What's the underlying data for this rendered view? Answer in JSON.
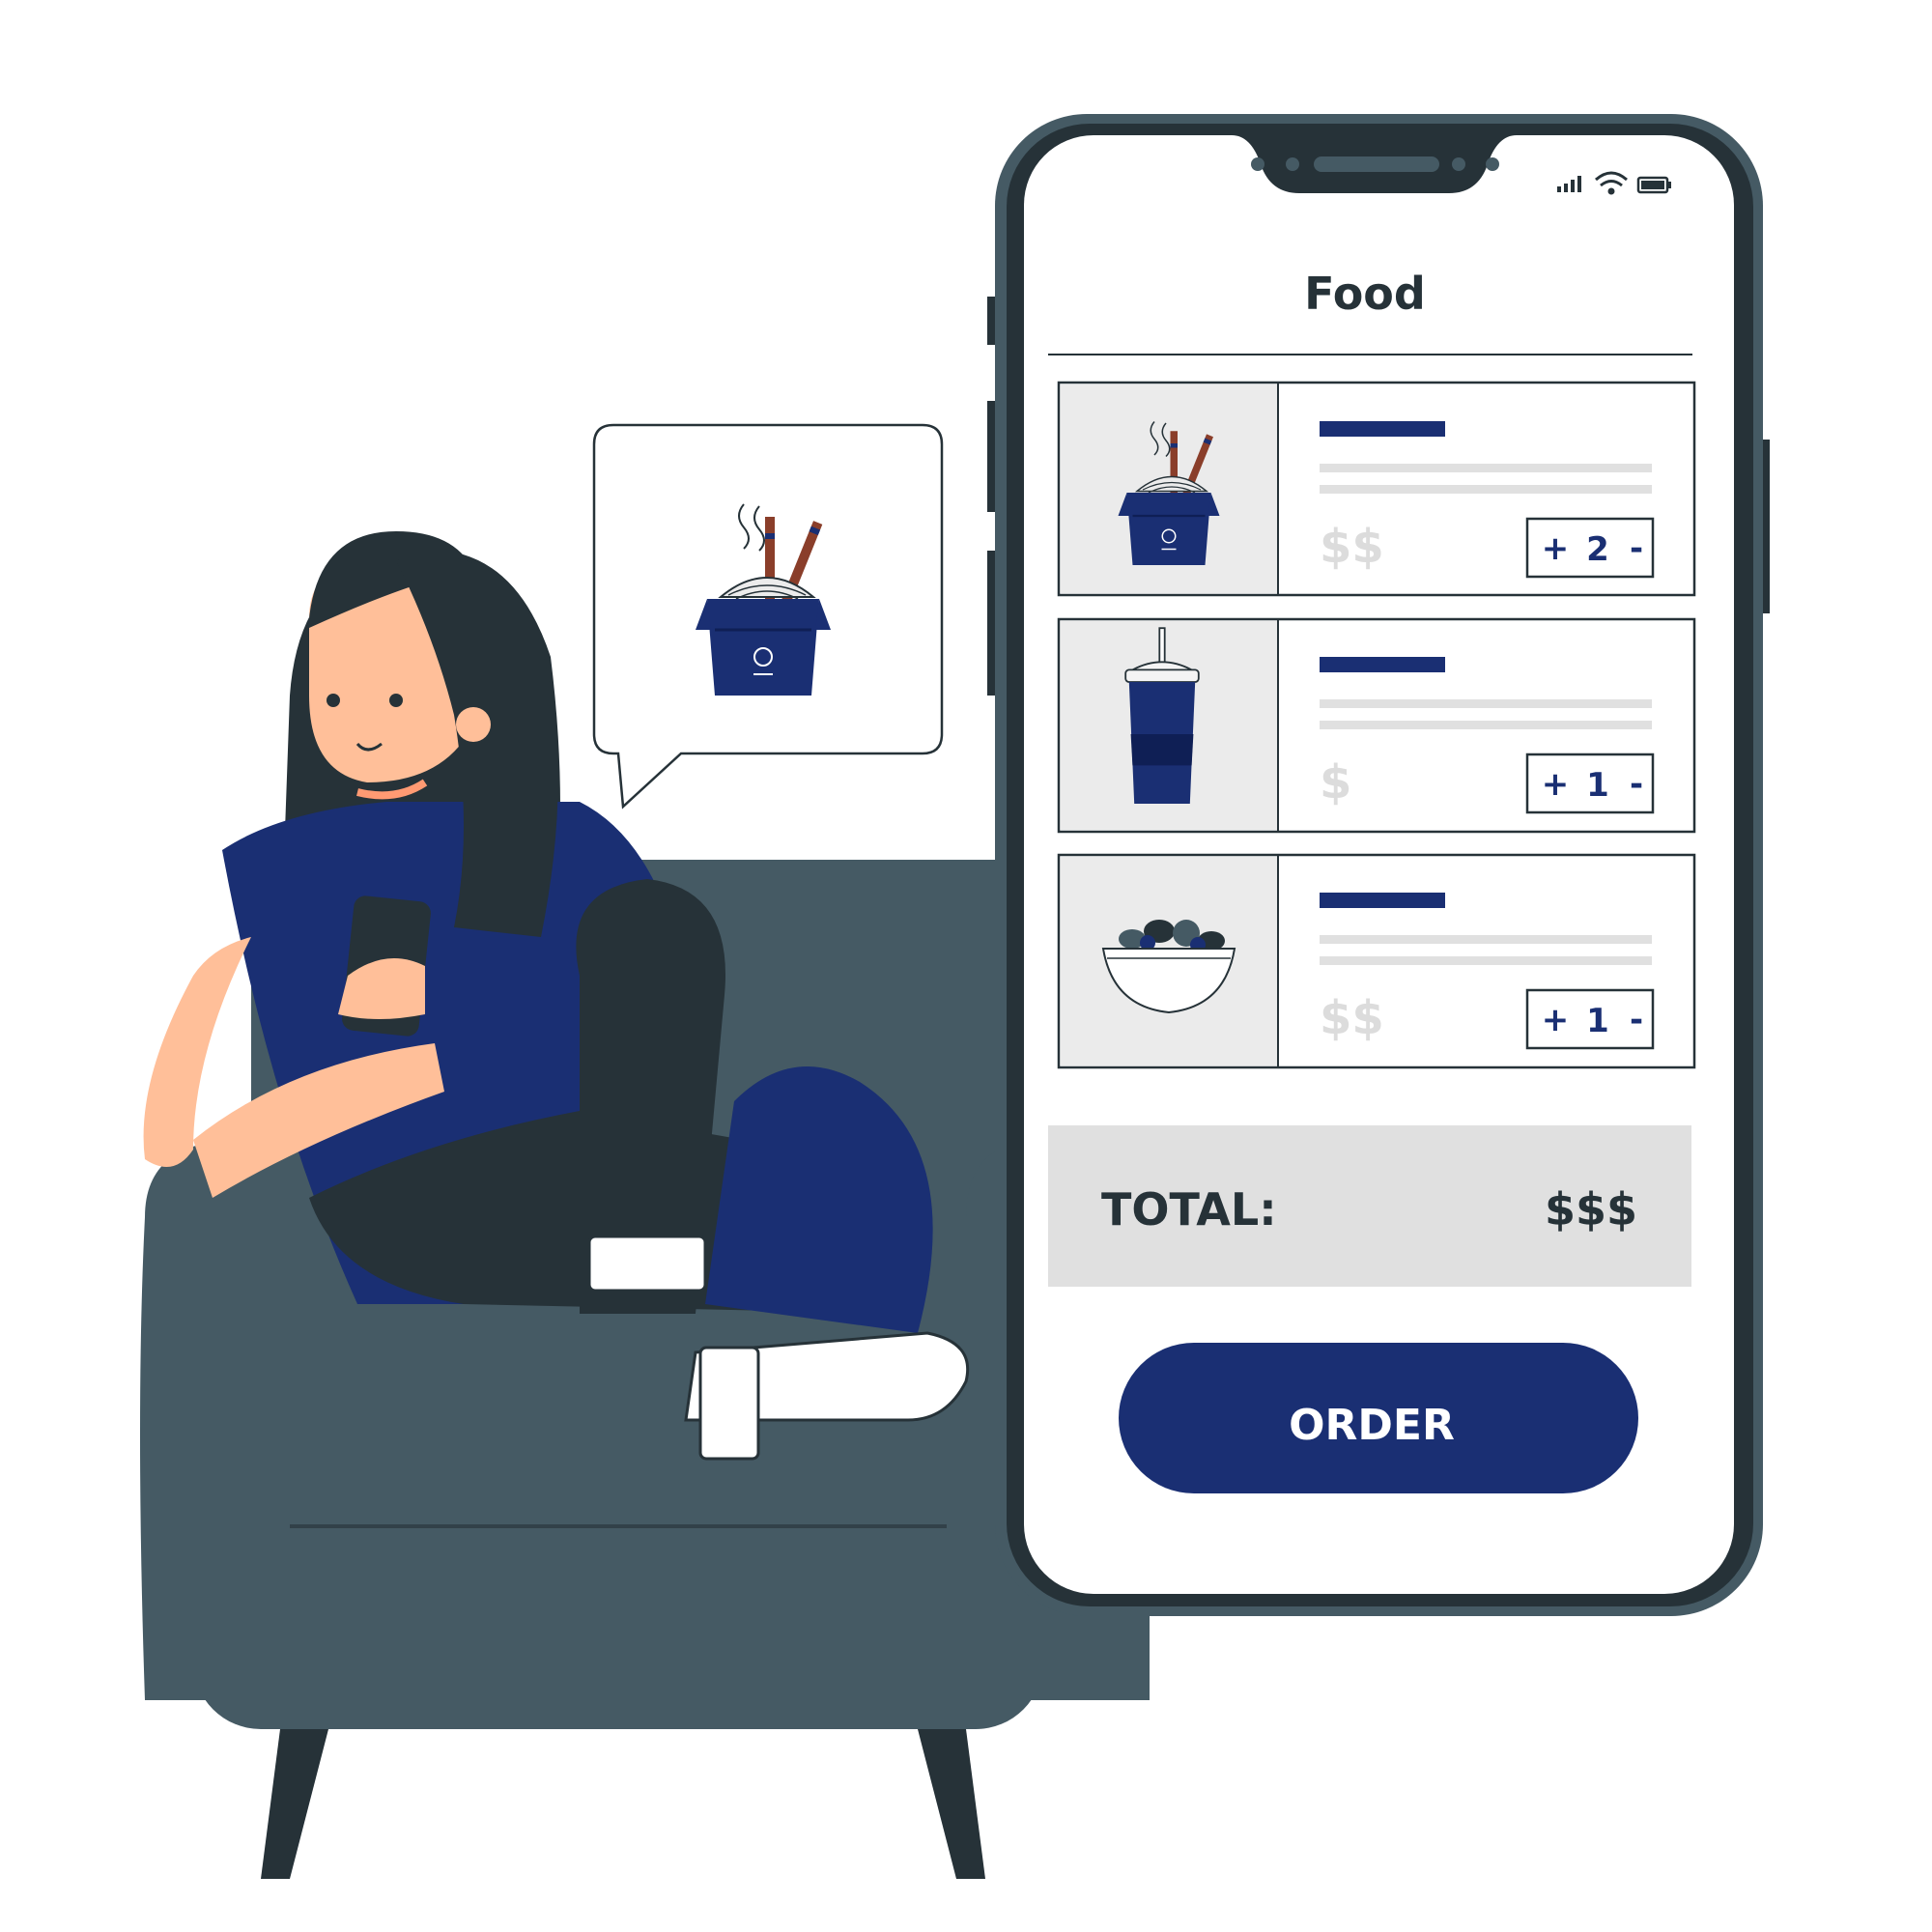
{
  "app": {
    "title": "Food"
  },
  "items": [
    {
      "icon": "noodle-box-icon",
      "price": "$$",
      "quantity": "2",
      "increment_label": "+",
      "decrement_label": "-"
    },
    {
      "icon": "drink-cup-icon",
      "price": "$",
      "quantity": "1",
      "increment_label": "+",
      "decrement_label": "-"
    },
    {
      "icon": "salad-bowl-icon",
      "price": "$$",
      "quantity": "1",
      "increment_label": "+",
      "decrement_label": "-"
    }
  ],
  "summary": {
    "total_label": "TOTAL:",
    "total_value": "$$$"
  },
  "actions": {
    "order_label": "ORDER"
  },
  "status_bar": {
    "icons": [
      "signal-icon",
      "wifi-icon",
      "battery-icon"
    ]
  },
  "speech_bubble": {
    "icon": "noodle-box-icon"
  },
  "colors": {
    "accent": "#1a2f73",
    "phone_frame": "#455a64",
    "dark": "#263238",
    "skin": "#ffbf99",
    "panel_gray": "#e0e0e0"
  }
}
